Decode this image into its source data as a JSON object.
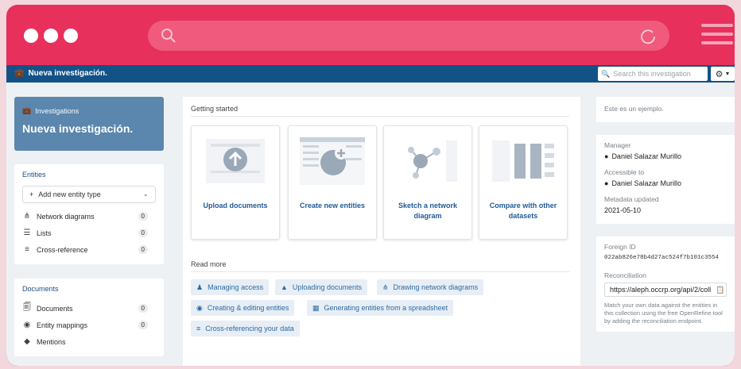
{
  "nav": {
    "brand": "Nueva investigación.",
    "search_placeholder": "Search this investigation"
  },
  "sidebar": {
    "hero_small": "Investigations",
    "hero_title": "Nueva investigación.",
    "entities_title": "Entities",
    "add_entity": "Add new entity type",
    "entity_items": [
      {
        "label": "Network diagrams",
        "count": "0"
      },
      {
        "label": "Lists",
        "count": "0"
      },
      {
        "label": "Cross-reference",
        "count": "0"
      }
    ],
    "documents_title": "Documents",
    "document_items": [
      {
        "label": "Documents",
        "count": "0"
      },
      {
        "label": "Entity mappings",
        "count": "0"
      },
      {
        "label": "Mentions",
        "count": ""
      }
    ]
  },
  "main": {
    "getting_started": "Getting started",
    "cards": [
      {
        "label": "Upload documents"
      },
      {
        "label": "Create new entities"
      },
      {
        "label": "Sketch a network diagram"
      },
      {
        "label": "Compare with other datasets"
      }
    ],
    "read_more": "Read more",
    "links": [
      "Managing access",
      "Uploading documents",
      "Drawing network diagrams",
      "Creating & editing entities",
      "Generating entities from a spreadsheet",
      "Cross-referencing your data"
    ]
  },
  "info": {
    "summary": "Este es un ejemplo.",
    "manager_label": "Manager",
    "manager": "Daniel Salazar Murillo",
    "accessible_label": "Accessible to",
    "accessible": "Daniel Salazar Murillo",
    "updated_label": "Metadata updated",
    "updated": "2021-05-10",
    "foreign_label": "Foreign ID",
    "foreign_id": "022ab826e78b4d27ac524f7b101c3554",
    "reconciliation_label": "Reconciliation",
    "reconciliation_url": "https://aleph.occrp.org/api/2/coll",
    "reconciliation_hint": "Match your own data against the entities in this collection using the free OpenRefine tool by adding the reconciliation endpoint."
  },
  "colors": {
    "chrome": "#e8305d",
    "navbar": "#135287",
    "hero": "#5b86ad",
    "link": "#2d6aa3"
  },
  "icons": {
    "briefcase": "briefcase-icon",
    "network": "network-icon",
    "list": "list-icon",
    "xref": "cross-reference-icon",
    "upload": "upload-icon",
    "user": "user-icon",
    "gear": "gear-icon"
  }
}
